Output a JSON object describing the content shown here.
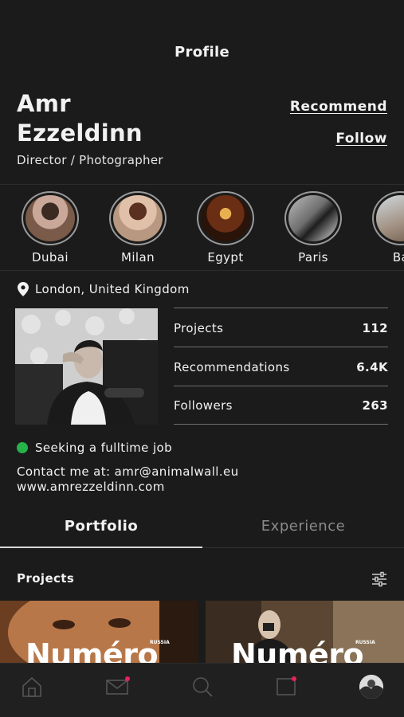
{
  "header": {
    "title": "Profile"
  },
  "profile": {
    "first_name": "Amr",
    "last_name": "Ezzeldinn",
    "role": "Director / Photographer",
    "recommend_label": "Recommend",
    "follow_label": "Follow"
  },
  "stories": [
    {
      "label": "Dubai"
    },
    {
      "label": "Milan"
    },
    {
      "label": "Egypt"
    },
    {
      "label": "Paris"
    },
    {
      "label": "Ba"
    }
  ],
  "location": "London, United Kingdom",
  "stats": [
    {
      "label": "Projects",
      "value": "112"
    },
    {
      "label": "Recommendations",
      "value": "6.4K"
    },
    {
      "label": "Followers",
      "value": "263"
    }
  ],
  "status": {
    "text": "Seeking a fulltime job",
    "color": "#27b14a"
  },
  "contact": {
    "line1": "Contact me at: amr@animalwall.eu",
    "line2": "www.amrezzeldinn.com"
  },
  "tabs": {
    "portfolio": "Portfolio",
    "experience": "Experience",
    "active": "Portfolio"
  },
  "projects": {
    "title": "Projects",
    "cards": [
      {
        "brand": "Numéro",
        "sub": "RUSSIA"
      },
      {
        "brand": "Numéro",
        "sub": "RUSSIA"
      }
    ]
  },
  "bottom_nav": [
    {
      "icon": "home-icon"
    },
    {
      "icon": "mail-icon",
      "badge": true
    },
    {
      "icon": "search-icon"
    },
    {
      "icon": "notification-icon",
      "badge": true
    },
    {
      "icon": "profile-avatar"
    }
  ],
  "colors": {
    "background": "#1b1b1b",
    "badge": "#e8245a",
    "status": "#27b14a"
  }
}
